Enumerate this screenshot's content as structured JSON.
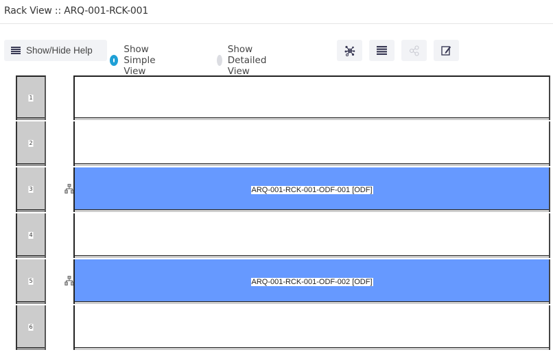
{
  "header": {
    "title": "Rack View :: ARQ-001-RCK-001"
  },
  "toolbar": {
    "help_label": "Show/Hide Help",
    "view_mode": {
      "options": [
        {
          "label": "Show Simple View",
          "selected": true
        },
        {
          "label": "Show Detailed View",
          "selected": false
        }
      ]
    },
    "icon_buttons": [
      {
        "icon": "network-topology-icon",
        "enabled": true
      },
      {
        "icon": "list-icon",
        "enabled": true
      },
      {
        "icon": "share-icon",
        "enabled": false
      },
      {
        "icon": "edit-icon",
        "enabled": true
      }
    ],
    "accent_color": "#1fa0d6"
  },
  "rack": {
    "occupied_color": "#6699ff",
    "slots": [
      {
        "number": "1",
        "device": null
      },
      {
        "number": "2",
        "device": null
      },
      {
        "number": "3",
        "device": "ARQ-001-RCK-001-ODF-001 [ODF]"
      },
      {
        "number": "4",
        "device": null
      },
      {
        "number": "5",
        "device": "ARQ-001-RCK-001-ODF-002 [ODF]"
      },
      {
        "number": "6",
        "device": null
      }
    ]
  }
}
